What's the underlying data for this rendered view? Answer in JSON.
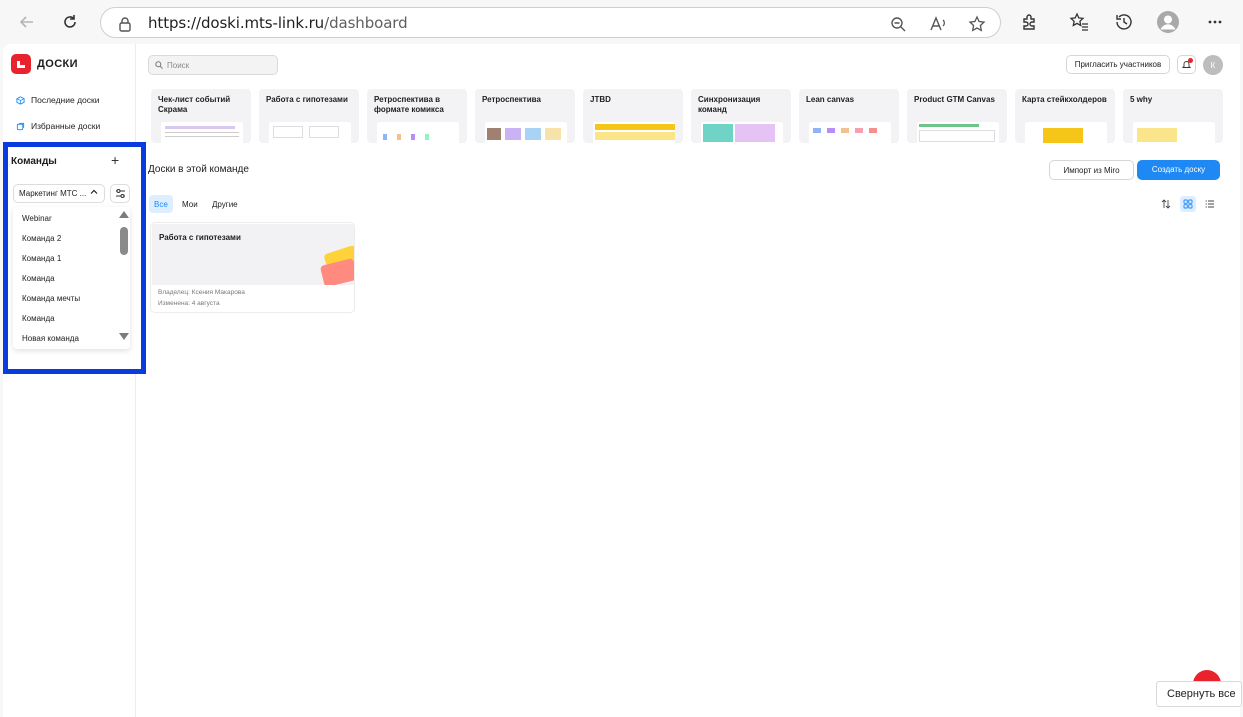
{
  "browser": {
    "url_host": "https://doski.mts-link.ru",
    "url_path": "/dashboard"
  },
  "sidebar": {
    "logo_text": "ДОСКИ",
    "recent_label": "Последние доски",
    "favorites_label": "Избранные доски"
  },
  "teams": {
    "title": "Команды",
    "selected": "Маркетинг МТС ...",
    "items": [
      "Webinar",
      "Команда 2",
      "Команда 1",
      "Команда",
      "Команда мечты",
      "Команда",
      "Новая команда"
    ]
  },
  "header": {
    "search_placeholder": "Поиск",
    "invite_label": "Пригласить участников",
    "avatar_letter": "К"
  },
  "templates": [
    {
      "title": "Чек-лист событий Скрама"
    },
    {
      "title": "Работа с гипотезами"
    },
    {
      "title": "Ретроспектива в формате комикса"
    },
    {
      "title": "Ретроспектива"
    },
    {
      "title": "JTBD"
    },
    {
      "title": "Синхронизация команд"
    },
    {
      "title": "Lean canvas"
    },
    {
      "title": "Product GTM Canvas"
    },
    {
      "title": "Карта стейкхолдеров"
    },
    {
      "title": "5 why"
    }
  ],
  "boards_section": {
    "title": "Доски в этой команде",
    "import_label": "Импорт из Miro",
    "create_label": "Создать доску",
    "tabs": [
      "Все",
      "Мои",
      "Другие"
    ],
    "active_tab": "Все"
  },
  "boards": [
    {
      "title": "Работа с гипотезами",
      "owner": "Владелец: Ксения Макарова",
      "modified": "Изменена: 4 августа"
    }
  ],
  "tooltip": "Свернуть все",
  "colors": {
    "accent": "#1e88f5",
    "brand_red": "#e8232e",
    "highlight_border": "#0a3bdf"
  }
}
